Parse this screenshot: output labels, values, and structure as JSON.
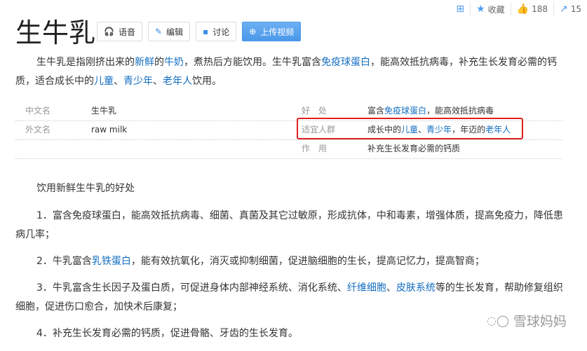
{
  "topbar": {
    "collect": "收藏",
    "likes": "188",
    "shares": "15"
  },
  "title": "生牛乳",
  "buttons": {
    "voice": "语音",
    "edit": "编辑",
    "discuss": "讨论",
    "upload": "上传视频"
  },
  "intro": {
    "p1": "生牛乳是指刚挤出来的",
    "l1": "新鲜",
    "p2": "的",
    "l2": "牛奶",
    "p3": "，煮热后方能饮用。生牛乳富含",
    "l3": "免疫球蛋白",
    "p4": "，能高效抵抗病毒，补充生长发育必需的钙质，适合成长中的",
    "l4": "儿童",
    "p5": "、",
    "l5": "青少年",
    "p6": "、",
    "l6": "老年人",
    "p7": "饮用。"
  },
  "info": {
    "cn_label": "中文名",
    "cn_value": "生牛乳",
    "en_label": "外文名",
    "en_value": "raw milk",
    "benefit_label": "好　处",
    "benefit_p1": "富含",
    "benefit_link": "免疫球蛋白",
    "benefit_p2": "，能高效抵抗病毒",
    "people_label": "适宜人群",
    "people_p1": "成长中的",
    "people_l1": "儿童",
    "people_p2": "、",
    "people_l2": "青少年",
    "people_p3": "，年迈的",
    "people_l3": "老年人",
    "use_label": "作　用",
    "use_value": "补充生长发育必需的钙质"
  },
  "body": {
    "heading": "饮用新鲜生牛乳的好处",
    "i1": "1．富含免疫球蛋白，能高效抵抗病毒、细菌、真菌及其它过敏原，形成抗体，中和毒素，增强体质，提高免疫力，降低患病几率；",
    "i2a": "2．牛乳富含",
    "i2l": "乳铁蛋白",
    "i2b": "，能有效抗氧化，消灭或抑制细菌，促进脑细胞的生长，提高记忆力，提高智商；",
    "i3a": "3．牛乳富含生长因子及蛋白质，可促进身体内部神经系统、消化系统、",
    "i3l1": "纤维细胞",
    "i3b": "、",
    "i3l2": "皮肤系统",
    "i3c": "等的生长发育，帮助修复组织细胞，促进伤口愈合，加快术后康复；",
    "i4": "4．补充生长发育必需的钙质，促进骨骼、牙齿的生长发育。"
  },
  "watermark": "雪球妈妈"
}
